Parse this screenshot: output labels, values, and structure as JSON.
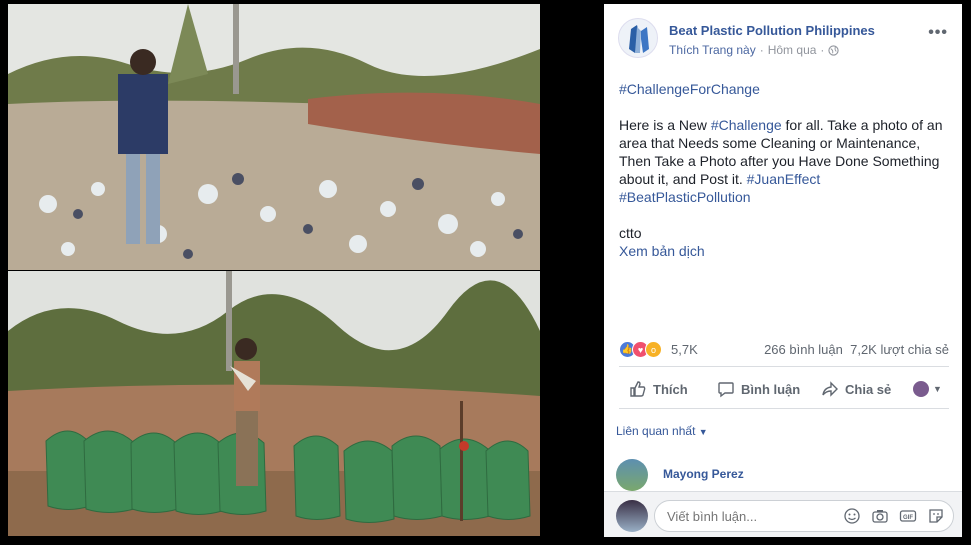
{
  "post": {
    "page_name": "Beat Plastic Pollution Philippines",
    "like_page": "Thích Trang này",
    "separator": "·",
    "time": "Hôm qua",
    "more": "•••",
    "hashtag_title": "#ChallengeForChange",
    "body_1": "Here is a New ",
    "body_hashtag": "#Challenge",
    "body_2": " for all. Take a photo of an area that Needs some Cleaning or Maintenance, Then Take a Photo after you Have Done Something about it, and Post it. ",
    "hashtag_juan": "#JuanEffect",
    "hashtag_beat": "#BeatPlasticPollution",
    "credit": "ctto",
    "translate": "Xem bản dịch"
  },
  "reactions": {
    "count": "5,7K",
    "comments": "266 bình luận",
    "shares": "7,2K lượt chia sẻ"
  },
  "actions": {
    "like": "Thích",
    "comment": "Bình luận",
    "share": "Chia sẻ"
  },
  "comments": {
    "filter": "Liên quan nhất",
    "first_commenter": "Mayong Perez",
    "write_placeholder": "Viết bình luận..."
  },
  "icons": [
    "globe-icon",
    "more-icon",
    "like-icon",
    "comment-icon",
    "share-icon",
    "emoji-icon",
    "camera-icon",
    "gif-icon",
    "sticker-icon"
  ],
  "colors": {
    "link": "#365899",
    "muted": "#90949c",
    "bag_green": "#3f8a54"
  }
}
